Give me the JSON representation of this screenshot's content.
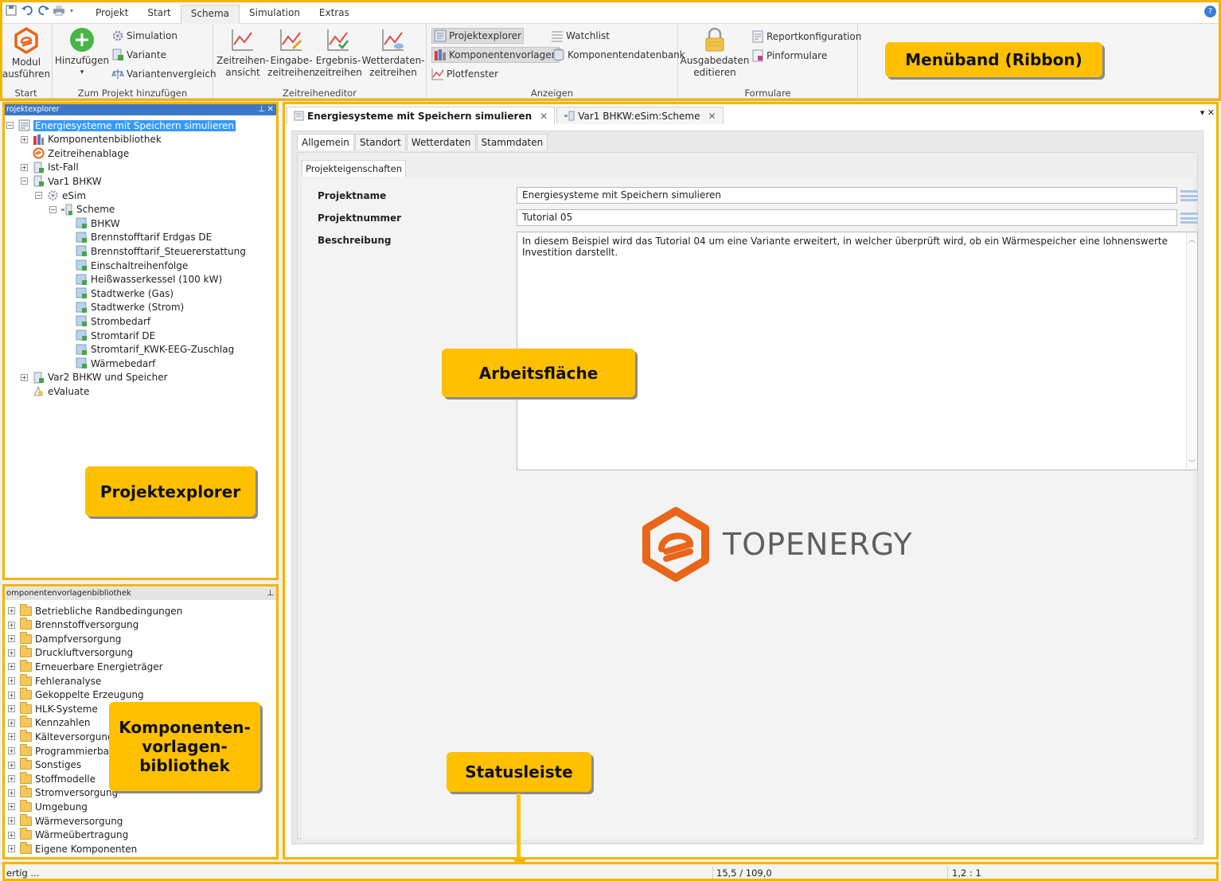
{
  "app": {
    "ribbon_tabs": [
      "Projekt",
      "Start",
      "Schema",
      "Simulation",
      "Extras"
    ],
    "active_tab": "Schema"
  },
  "ribbon": {
    "start": {
      "label": "Start",
      "modul_line1": "Modul",
      "modul_line2": "ausführen"
    },
    "projekt": {
      "label": "Zum Projekt hinzufügen",
      "hinzufuegen": "Hinzufügen",
      "dropdown": "▾",
      "simulation": "Simulation",
      "variante": "Variante",
      "variantenvergleich": "Variantenvergleich"
    },
    "zeitreihen": {
      "label": "Zeitreiheneditor",
      "buttons": [
        {
          "l1": "Zeitreihen-",
          "l2": "ansicht"
        },
        {
          "l1": "Eingabe-",
          "l2": "zeitreihen"
        },
        {
          "l1": "Ergebnis-",
          "l2": "zeitreihen"
        },
        {
          "l1": "Wetterdaten-",
          "l2": "zeitreihen"
        }
      ]
    },
    "anzeigen": {
      "label": "Anzeigen",
      "projektexplorer": "Projektexplorer",
      "komponentenvorlagen": "Komponentenvorlagen",
      "plotfenster": "Plotfenster",
      "watchlist": "Watchlist",
      "komponentendatenbank": "Komponentendatenbank"
    },
    "formulare": {
      "label": "Formulare",
      "ausgabe_l1": "Ausgabedaten",
      "ausgabe_l2": "editieren",
      "reportkonfiguration": "Reportkonfiguration",
      "pinformulare": "Pinformulare"
    }
  },
  "callouts": {
    "ribbon": "Menüband (Ribbon)",
    "explorer": "Projektexplorer",
    "workspace": "Arbeitsfläche",
    "library_l1": "Komponenten-",
    "library_l2": "vorlagen-",
    "library_l3": "bibliothek",
    "status": "Statusleiste"
  },
  "explorer": {
    "header": "rojektexplorer",
    "pin": "⊥",
    "close": "✕",
    "root": "Energiesysteme mit Speichern simulieren",
    "items": [
      "Komponentenbibliothek",
      "Zeitreihenablage",
      "Ist-Fall",
      "Var1 BHKW",
      "eSim",
      "Scheme",
      "BHKW",
      "Brennstofftarif Erdgas DE",
      "Brennstofftarif_Steuererstattung",
      "Einschaltreihenfolge",
      "Heißwasserkessel (100 kW)",
      "Stadtwerke (Gas)",
      "Stadtwerke (Strom)",
      "Strombedarf",
      "Stromtarif DE",
      "Stromtarif_KWK-EEG-Zuschlag",
      "Wärmebedarf",
      "Var2 BHKW und Speicher",
      "eValuate"
    ]
  },
  "library": {
    "header": "omponentenvorlagenbibliothek",
    "pin": "⊥",
    "items": [
      "Betriebliche Randbedingungen",
      "Brennstoffversorgung",
      "Dampfversorgung",
      "Druckluftversorgung",
      "Erneuerbare Energieträger",
      "Fehleranalyse",
      "Gekoppelte Erzeugung",
      "HLK-Systeme",
      "Kennzahlen",
      "Kälteversorgung",
      "Programmierbare",
      "Sonstiges",
      "Stoffmodelle",
      "Stromversorgung",
      "Umgebung",
      "Wärmeversorgung",
      "Wärmeübertragung",
      "Eigene Komponenten"
    ]
  },
  "document": {
    "tabs": [
      {
        "label": "Energiesysteme mit Speichern simulieren",
        "close": "✕"
      },
      {
        "label": "Var1 BHKW:eSim:Scheme",
        "close": "✕"
      }
    ],
    "menu": "▾ ✕",
    "subtabs": [
      "Allgemein",
      "Standort",
      "Wetterdaten",
      "Stammdaten"
    ],
    "section_tab": "Projekteigenschaften",
    "fields": {
      "projektname_label": "Projektname",
      "projektname_value": "Energiesysteme mit Speichern simulieren",
      "projektnummer_label": "Projektnummer",
      "projektnummer_value": "Tutorial 05",
      "beschreibung_label": "Beschreibung",
      "beschreibung_value": "In diesem Beispiel wird das Tutorial 04 um eine Variante erweitert, in welcher überprüft wird, ob ein Wärmespeicher eine lohnenswerte Investition darstellt."
    },
    "logo_text": "TOPENERGY"
  },
  "status": {
    "text": "ertig ...",
    "coords": "15,5 / 109,0",
    "zoom": "1,2 : 1"
  },
  "colors": {
    "highlight": "#f5b400",
    "callout": "#ffc000",
    "brand_orange": "#e8651a",
    "selection": "#3399ff"
  }
}
